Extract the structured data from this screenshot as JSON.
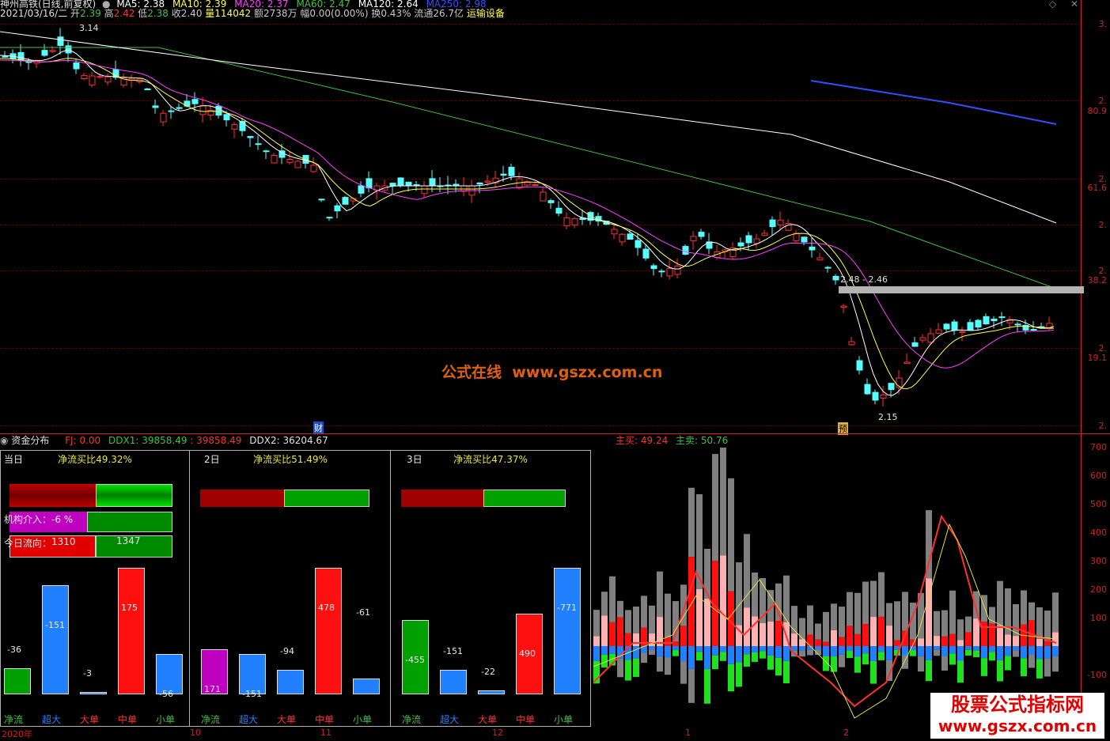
{
  "header": {
    "stock": "神州高铁(日线,前复权)",
    "ma5": "MA5: 2.38",
    "ma10": "MA10: 2.39",
    "ma20": "MA20: 2.37",
    "ma60": "MA60: 2.47",
    "ma120": "MA120: 2.64",
    "ma250": "MA250: 2.98",
    "date": "2021/03/16/二",
    "open_label": "开",
    "open": "2.39",
    "high_label": "高",
    "high": "2.42",
    "low_label": "低",
    "low": "2.38",
    "close": "收2.40",
    "volume": "量114042",
    "amount": "额2738万",
    "change": "幅0.00(0.00%)",
    "turnover": "换0.43%",
    "float": "流通26.7亿",
    "industry": "运输设备"
  },
  "price_axis": [
    "3.",
    "2.",
    "80.9",
    "2.",
    "61.6",
    "2.",
    "2.",
    "38.2",
    "2.",
    "19.1",
    "2."
  ],
  "annotations": {
    "high_mark": "3.14",
    "low_mark": "2.15",
    "range_mark": "2.48 - 2.46",
    "cai_badge": "财",
    "yu_badge": "预"
  },
  "watermark": {
    "center": "公式在线  www.gszx.com.cn",
    "corner_top": "股票公式指标网",
    "corner_bottom": "www.gszx.com.cn"
  },
  "lower_header": {
    "title": "资金分布",
    "fj": "FJ: 0.00",
    "ddx1": "DDX1: 39858.49",
    "ddx1b": ": 39858.49",
    "ddx2": "DDX2: 36204.67",
    "zhumai": "主买: 49.24",
    "zhumaic": "主卖: 50.76"
  },
  "lower_axis": [
    "700",
    "600",
    "500",
    "400",
    "300",
    "200",
    "100",
    "-100"
  ],
  "panels": [
    {
      "title": "当日",
      "ratio": "净流买比49.32%",
      "inst_label": "机构介入：-6 %",
      "flow_label": "今日流向：",
      "flow_left": "1310",
      "flow_right": "1347",
      "values": [
        "-36",
        "-151",
        "-3",
        "175",
        "-56"
      ]
    },
    {
      "title": "2日",
      "ratio": "净流买比51.49%",
      "values": [
        "171",
        "-151",
        "-94",
        "478",
        "-61"
      ]
    },
    {
      "title": "3日",
      "ratio": "净流买比47.37%",
      "values": [
        "-455",
        "-151",
        "-22",
        "490",
        "-771"
      ]
    }
  ],
  "categories": [
    "净流",
    "超大",
    "大单",
    "中单",
    "小单"
  ],
  "dates": [
    "2020年",
    "10",
    "11",
    "12",
    "1",
    "2"
  ],
  "colors": {
    "up": "#ff3030",
    "down": "#54ffff",
    "ma5": "#ffffff",
    "ma10": "#ffff50",
    "ma20": "#ff40ff",
    "ma60": "#40c040",
    "ma120": "#ffffff",
    "ma250": "#3050ff",
    "red": "#ff1010",
    "green": "#00c000",
    "blue": "#2080ff",
    "magenta": "#c000c0"
  }
}
